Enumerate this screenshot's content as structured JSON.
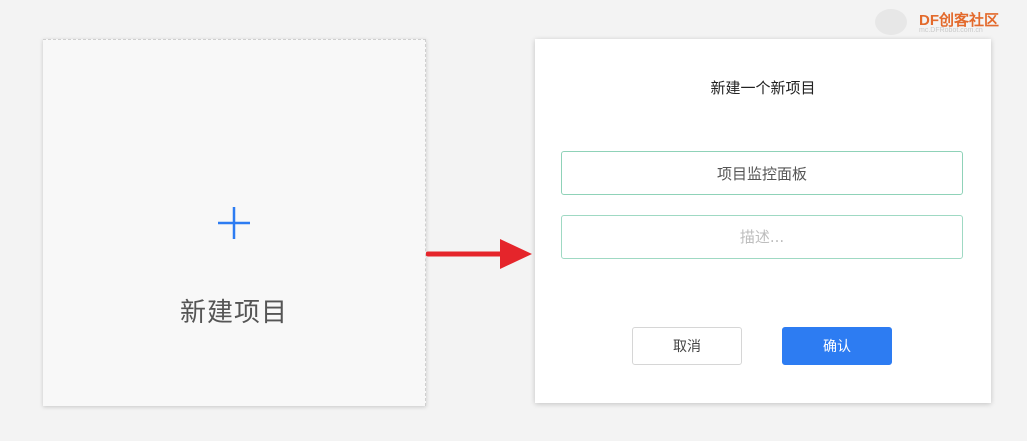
{
  "new_project_card": {
    "label": "新建项目",
    "icon": "plus-icon"
  },
  "arrow": {
    "icon": "arrow-right-icon",
    "color": "#e5252b"
  },
  "dialog": {
    "title": "新建一个新项目",
    "name_value": "项目监控面板",
    "description_placeholder": "描述...",
    "cancel_label": "取消",
    "confirm_label": "确认"
  },
  "watermark": {
    "brand": "DF创客社区",
    "url": "mc.DFRobot.com.cn"
  },
  "colors": {
    "accent": "#2d7cf2",
    "input_border": "#8fd2b8",
    "arrow": "#e5252b",
    "brand": "#e36a2c"
  }
}
